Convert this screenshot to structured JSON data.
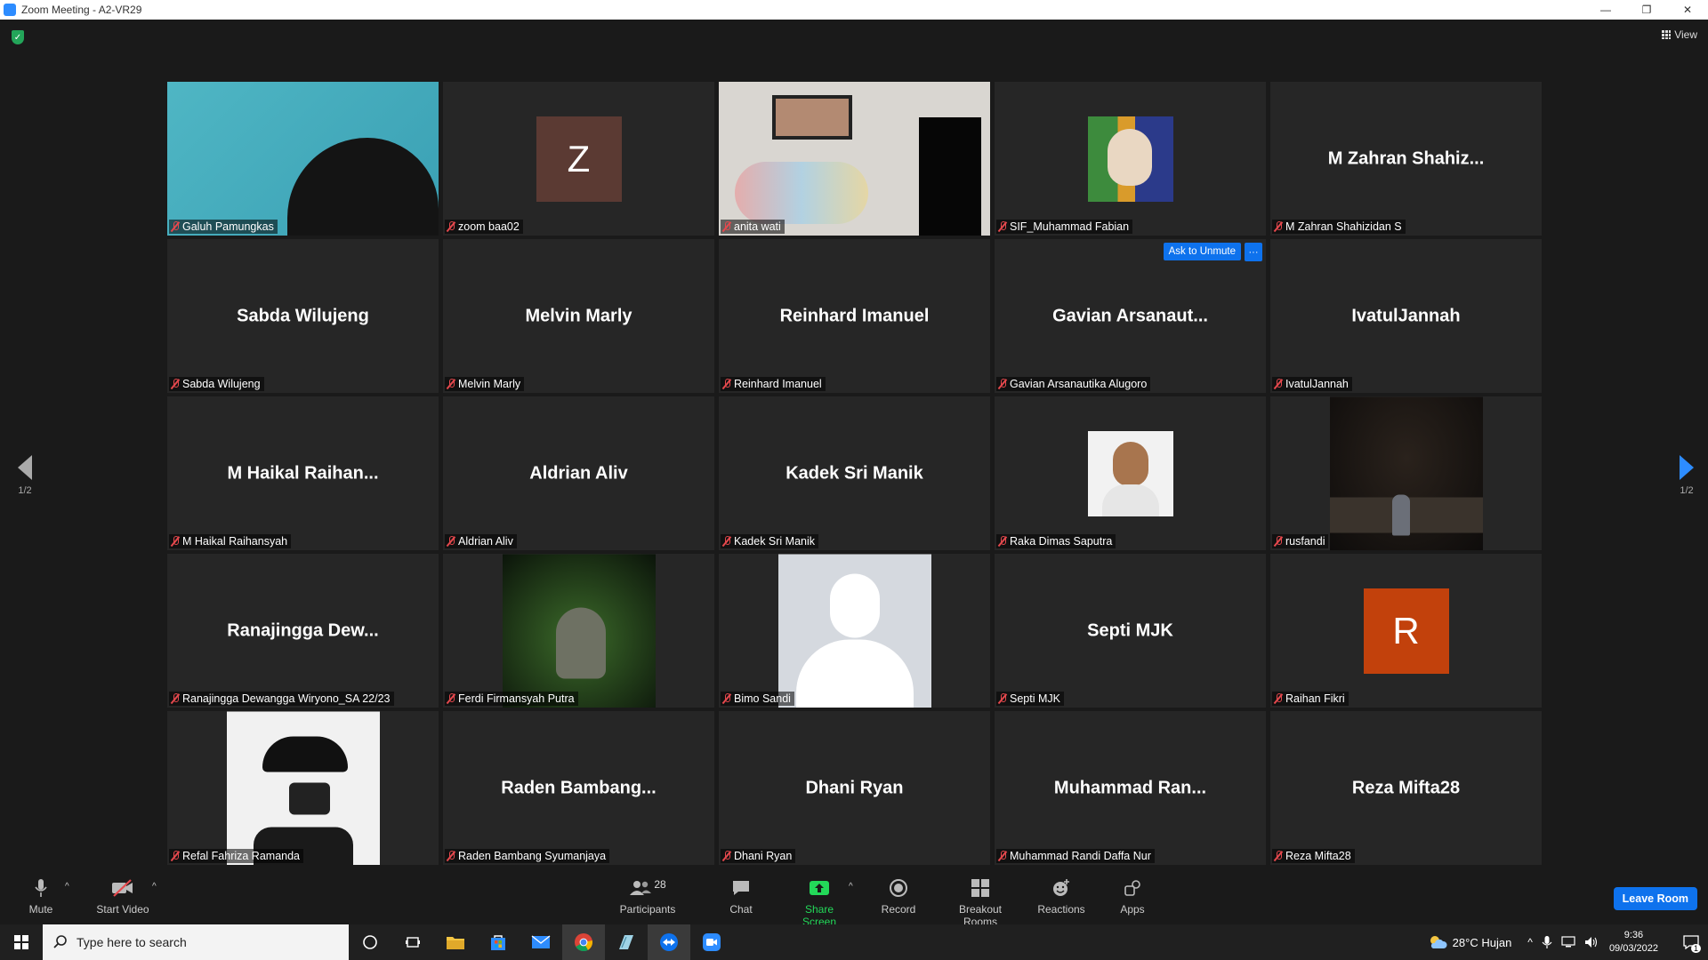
{
  "window": {
    "title": "Zoom Meeting - A2-VR29",
    "minimize": "—",
    "restore": "❐",
    "close": "✕"
  },
  "header": {
    "view_label": "View"
  },
  "pager": {
    "left": "1/2",
    "right": "1/2"
  },
  "tiles": [
    {
      "name": "Galuh Pamungkas",
      "big": "",
      "kind": "video"
    },
    {
      "name": "zoom baa02",
      "big": "",
      "kind": "letter",
      "letter": "Z",
      "color": "#5b3a33"
    },
    {
      "name": "anita wati",
      "big": "",
      "kind": "video",
      "active": true
    },
    {
      "name": "SIF_Muhammad Fabian",
      "big": "",
      "kind": "photo"
    },
    {
      "name": "M Zahran Shahizidan S",
      "big": "M Zahran Shahiz...",
      "kind": "name"
    },
    {
      "name": "Sabda Wilujeng",
      "big": "Sabda Wilujeng",
      "kind": "name"
    },
    {
      "name": "Melvin Marly",
      "big": "Melvin Marly",
      "kind": "name"
    },
    {
      "name": "Reinhard Imanuel",
      "big": "Reinhard Imanuel",
      "kind": "name"
    },
    {
      "name": "Gavian Arsanautika Alugoro",
      "big": "Gavian  Arsanaut...",
      "kind": "name",
      "ask_unmute": "Ask to Unmute",
      "more": "···"
    },
    {
      "name": "IvatulJannah",
      "big": "IvatulJannah",
      "kind": "name"
    },
    {
      "name": "M Haikal Raihansyah",
      "big": "M  Haikal  Raihan...",
      "kind": "name"
    },
    {
      "name": "Aldrian Aliv",
      "big": "Aldrian Aliv",
      "kind": "name"
    },
    {
      "name": "Kadek Sri Manik",
      "big": "Kadek Sri Manik",
      "kind": "name"
    },
    {
      "name": "Raka Dimas Saputra",
      "big": "",
      "kind": "photo"
    },
    {
      "name": "rusfandi",
      "big": "",
      "kind": "photo"
    },
    {
      "name": "Ranajingga Dewangga Wiryono_SA 22/23",
      "big": "Ranajingga  Dew...",
      "kind": "name"
    },
    {
      "name": "Ferdi Firmansyah Putra",
      "big": "",
      "kind": "photo"
    },
    {
      "name": "Bimo Sandi",
      "big": "",
      "kind": "photo"
    },
    {
      "name": "Septi MJK",
      "big": "Septi MJK",
      "kind": "name"
    },
    {
      "name": "Raihan Fikri",
      "big": "",
      "kind": "letter",
      "letter": "R",
      "color": "#c2410c"
    },
    {
      "name": "Refal Fahriza Ramanda",
      "big": "",
      "kind": "photo"
    },
    {
      "name": "Raden Bambang Syumanjaya",
      "big": "Raden  Bambang...",
      "kind": "name"
    },
    {
      "name": "Dhani Ryan",
      "big": "Dhani Ryan",
      "kind": "name"
    },
    {
      "name": "Muhammad Randi Daffa Nur",
      "big": "Muhammad  Ran...",
      "kind": "name"
    },
    {
      "name": "Reza Mifta28",
      "big": "Reza Mifta28",
      "kind": "name"
    }
  ],
  "toolbar": {
    "mute": "Mute",
    "start_video": "Start Video",
    "participants": "Participants",
    "participants_count": "28",
    "chat": "Chat",
    "share_screen": "Share Screen",
    "record": "Record",
    "breakout_rooms": "Breakout Rooms",
    "reactions": "Reactions",
    "apps": "Apps",
    "leave": "Leave Room",
    "caret": "^"
  },
  "taskbar": {
    "search_placeholder": "Type here to search",
    "weather": "28°C  Hujan",
    "time": "9:36",
    "date": "09/03/2022",
    "notification_count": "1"
  },
  "colors": {
    "accent_blue": "#0e72ed",
    "share_green": "#23d959",
    "muted_red": "#e5484d",
    "active_speaker": "#e8e89a"
  }
}
